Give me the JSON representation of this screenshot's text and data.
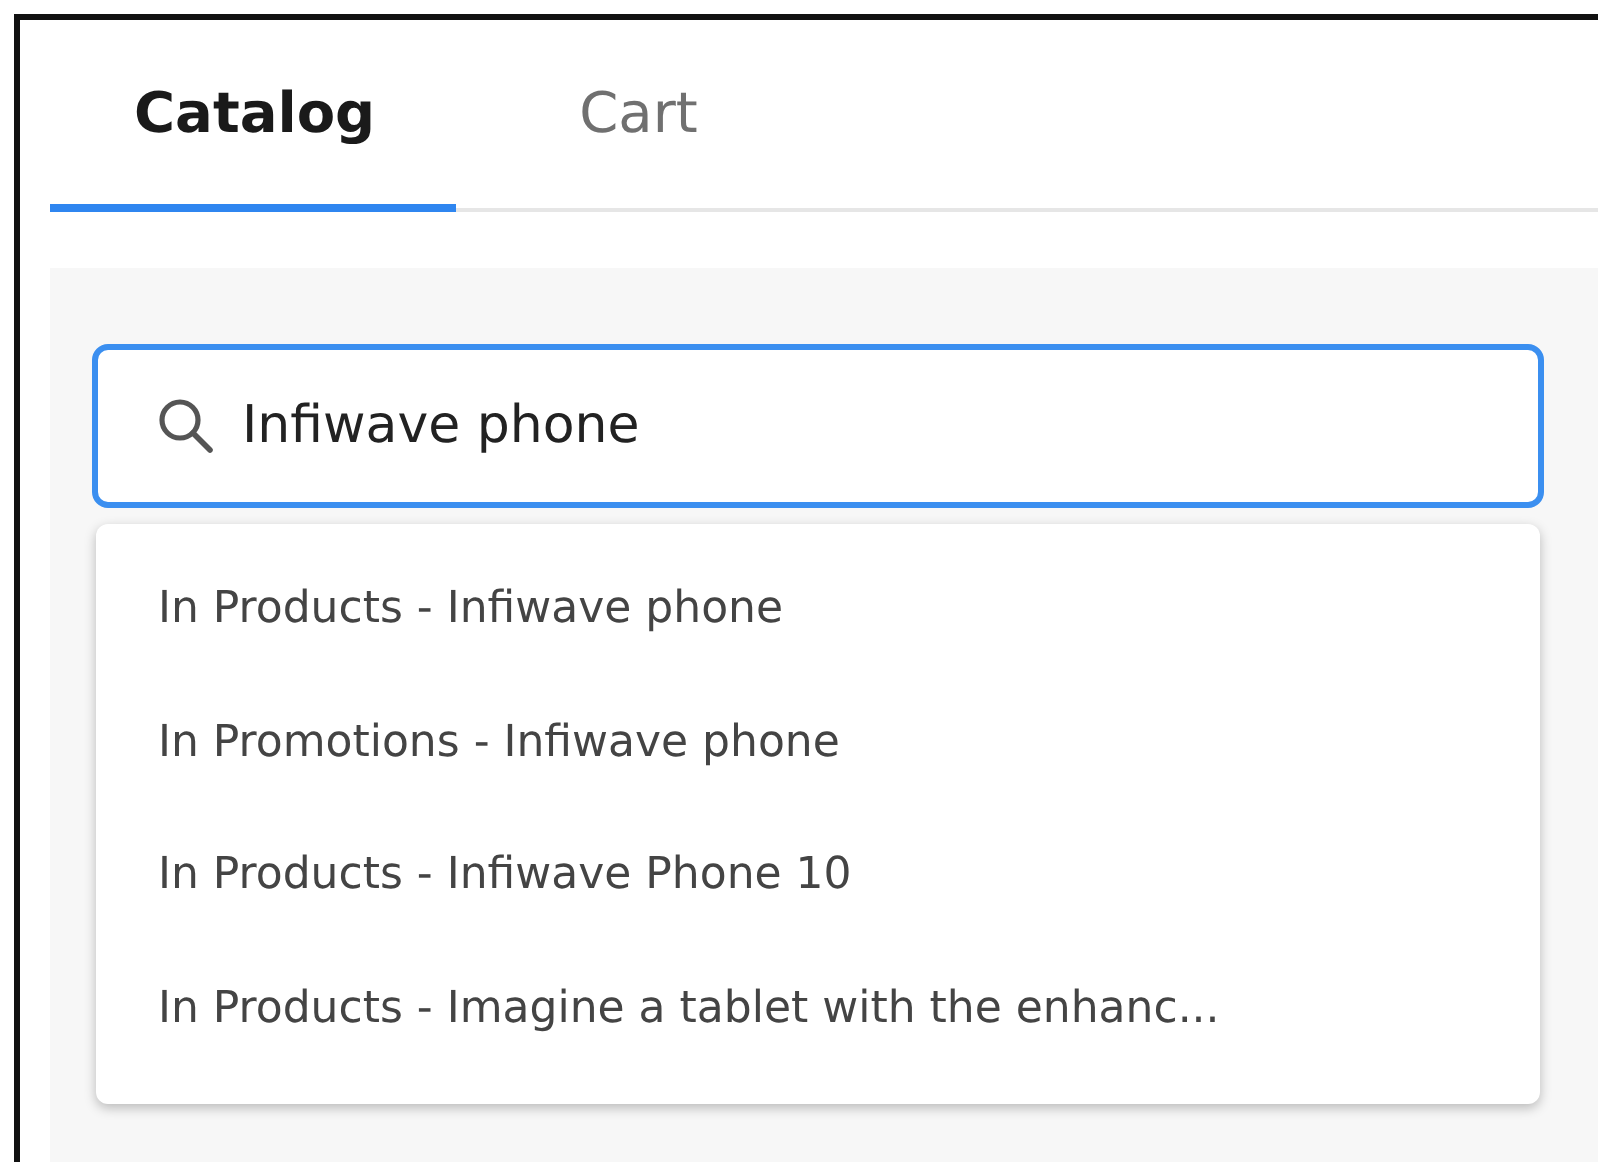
{
  "tabs": [
    {
      "label": "Catalog",
      "selected": true
    },
    {
      "label": "Cart",
      "selected": false
    }
  ],
  "search": {
    "value": "Infiwave phone"
  },
  "suggestions": [
    {
      "label": "In Products - Infiwave phone"
    },
    {
      "label": "In Promotions - Infiwave phone"
    },
    {
      "label": "In Products - Infiwave Phone 10"
    },
    {
      "label": "In Products - Imagine a tablet with the enhanc..."
    }
  ]
}
